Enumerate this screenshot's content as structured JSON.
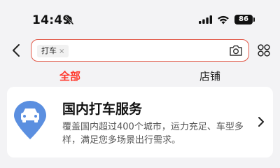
{
  "status_bar": {
    "time": "14:49",
    "battery": "86",
    "icons": [
      "bell-slash-icon",
      "cellular-signal-icon",
      "wifi-icon",
      "battery-icon"
    ]
  },
  "header": {
    "search_chip": "打车",
    "chip_clear": "×",
    "icons": [
      "back-chevron-icon",
      "camera-icon",
      "grid-menu-icon"
    ],
    "accent_color": "#e25a4a"
  },
  "tabs": [
    {
      "label": "全部",
      "active": true
    },
    {
      "label": "店铺",
      "active": false
    }
  ],
  "result_card": {
    "title": "国内打车服务",
    "description": "覆盖国内超过400个城市，运力充足、车型多样，满足您多场景出行需求。",
    "icon": "car-location-pin-icon",
    "icon_color": "#5b8fe0"
  }
}
